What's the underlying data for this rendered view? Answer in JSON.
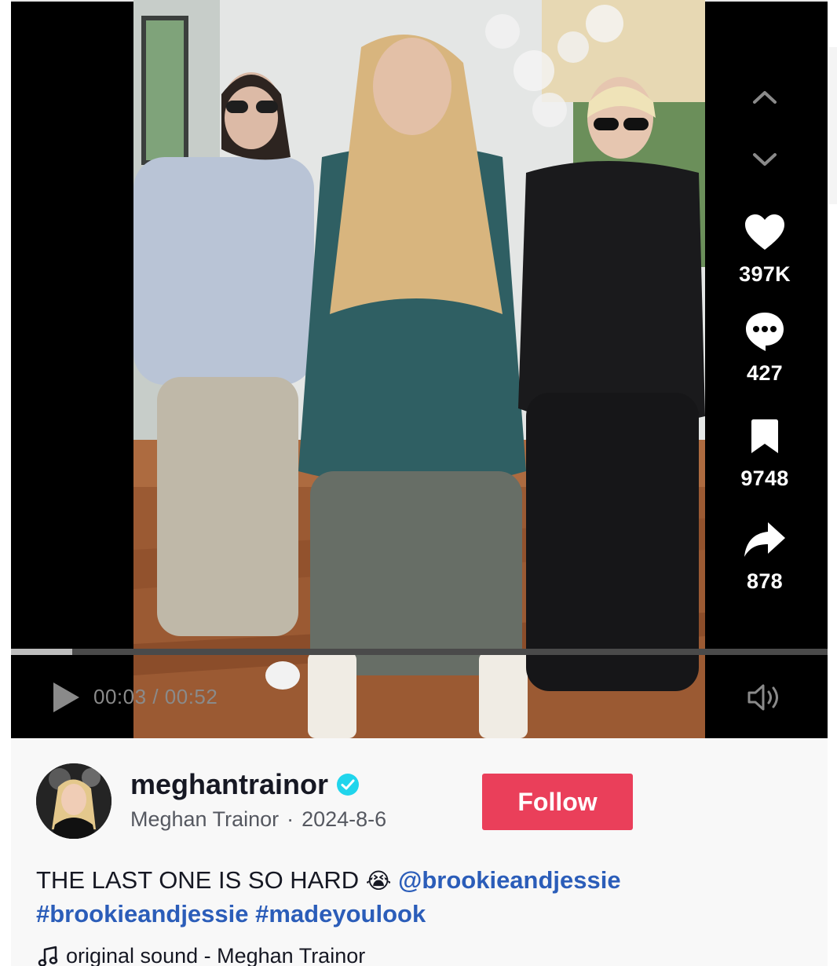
{
  "player": {
    "time_current": "00:03",
    "time_total": "00:52",
    "time_separator": "/",
    "progress_fraction": 0.075
  },
  "actions": {
    "likes": "397K",
    "comments": "427",
    "saves": "9748",
    "shares": "878"
  },
  "icons": {
    "nav_up": "chevron-up-icon",
    "nav_down": "chevron-down-icon",
    "like": "heart-icon",
    "comment": "comment-bubble-icon",
    "save": "bookmark-icon",
    "share": "share-arrow-icon",
    "play": "play-icon",
    "volume": "volume-icon",
    "verified": "verified-badge-icon",
    "music": "music-note-icon"
  },
  "author": {
    "username": "meghantrainor",
    "display_name": "Meghan Trainor",
    "date": "2024-8-6",
    "separator": "·"
  },
  "follow_label": "Follow",
  "caption": {
    "text": "THE LAST ONE IS SO HARD",
    "emoji": "😭",
    "mention": "@brookieandjessie",
    "hashtags": [
      "#brookieandjessie",
      "#madeyoulook"
    ]
  },
  "music": {
    "label": "original sound - Meghan Trainor"
  },
  "colors": {
    "follow_button": "#ea3f5a",
    "link": "#2b5db9",
    "verified": "#20d5ec",
    "player_bg": "#000000",
    "panel_bg": "#f8f8f8"
  }
}
